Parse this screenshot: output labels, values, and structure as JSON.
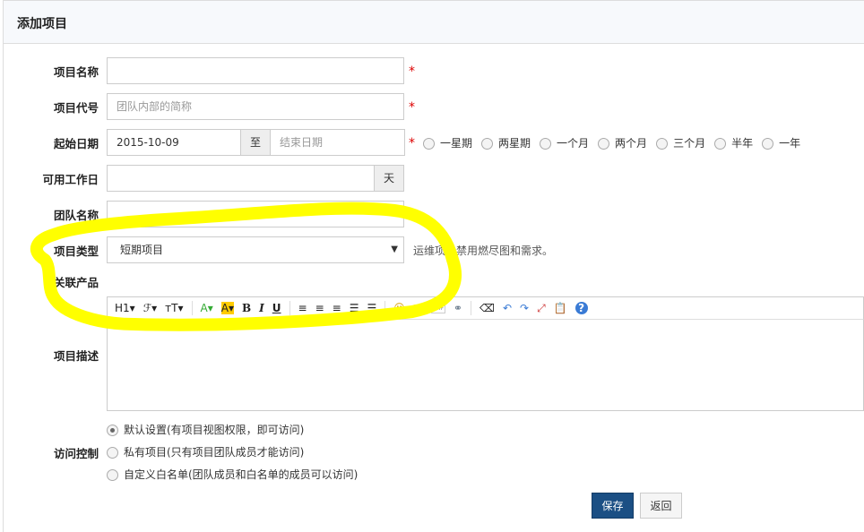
{
  "header": {
    "title": "添加项目"
  },
  "form": {
    "name": {
      "label": "项目名称",
      "value": ""
    },
    "code": {
      "label": "项目代号",
      "placeholder": "团队内部的简称"
    },
    "dates": {
      "label": "起始日期",
      "start": "2015-10-09",
      "to": "至",
      "end_placeholder": "结束日期",
      "presets": [
        "一星期",
        "两星期",
        "一个月",
        "两个月",
        "三个月",
        "半年",
        "一年"
      ]
    },
    "days": {
      "label": "可用工作日",
      "unit": "天"
    },
    "team": {
      "label": "团队名称"
    },
    "type": {
      "label": "项目类型",
      "value": "短期项目",
      "hint": "运维项目禁用燃尽图和需求。"
    },
    "products": {
      "label": "关联产品"
    },
    "desc": {
      "label": "项目描述",
      "toolbar": [
        "H1▾",
        "ℱ▾",
        "тT▾",
        "A▾",
        "A▾",
        "B",
        "I",
        "U",
        "≡",
        "≡",
        "≡",
        "☰",
        "☰",
        "☺",
        "▣",
        "C#",
        "⚭",
        "⌫",
        "↶",
        "↷",
        "⤢",
        "📋",
        "?"
      ]
    },
    "acl": {
      "label": "访问控制",
      "options": [
        "默认设置(有项目视图权限，即可访问)",
        "私有项目(只有项目团队成员才能访问)",
        "自定义白名单(团队成员和白名单的成员可以访问)"
      ],
      "selected": 0
    },
    "save": "保存",
    "back": "返回"
  },
  "colors": {
    "primary": "#1b4f84",
    "required": "#dd0000",
    "highlight": "#ffff00"
  }
}
